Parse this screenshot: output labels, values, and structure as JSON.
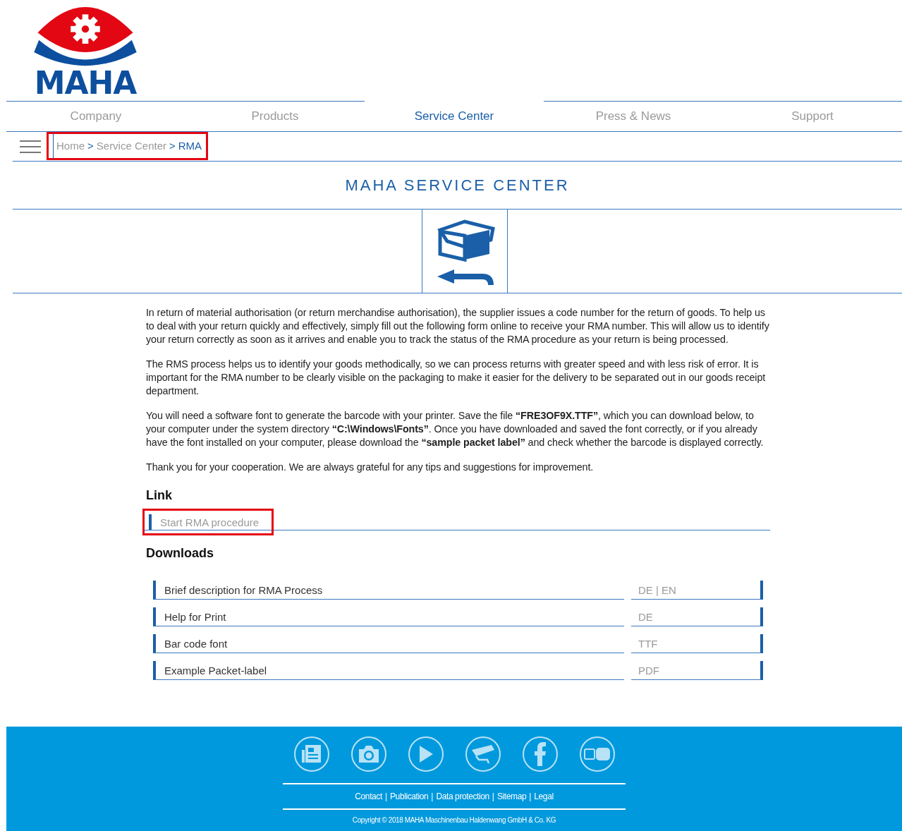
{
  "logo": {
    "text": "MAHA"
  },
  "nav": [
    {
      "label": "Company",
      "selected": false
    },
    {
      "label": "Products",
      "selected": false
    },
    {
      "label": "Service Center",
      "selected": true
    },
    {
      "label": "Press & News",
      "selected": false
    },
    {
      "label": "Support",
      "selected": false
    }
  ],
  "breadcrumb": {
    "highlighted": true,
    "items": [
      {
        "label": "Home",
        "current": false
      },
      {
        "label": "Service Center",
        "current": false
      },
      {
        "label": "RMA",
        "current": true
      }
    ],
    "separator": ">"
  },
  "title": "MAHA SERVICE CENTER",
  "paragraphs": [
    "In return of material authorisation (or return merchandise authorisation), the supplier issues a code number for the return of goods. To help us to deal with your return quickly and effectively, simply fill out the following form online to receive your RMA number. This will allow us to identify your return correctly as soon as it arrives and enable you to track the status of the RMA procedure as your return is being processed.",
    "The RMS process helps us to identify your goods methodically, so we can process returns with greater speed and with less risk of error. It is important for the RMA number to be clearly visible on the packaging to make it easier for the delivery to be separated out in our goods receipt department.",
    "You will need a software font to generate the barcode with your printer. Save the file **“FRE3OF9X.TTF”**, which you can download below, to your computer under the system directory **“C:\\Windows\\Fonts”**. Once you have downloaded and saved the font correctly, or if you already have the font installed on your computer, please download the **“sample packet label”** and check whether the barcode is displayed correctly.",
    "Thank you for your cooperation. We are always grateful for any tips and suggestions for improvement."
  ],
  "link_section": {
    "heading": "Link",
    "link": {
      "label": "Start RMA procedure",
      "highlighted": true
    }
  },
  "downloads": {
    "heading": "Downloads",
    "rows": [
      {
        "label": "Brief description for RMA Process",
        "format": "DE | EN"
      },
      {
        "label": "Help for Print",
        "format": "DE"
      },
      {
        "label": "Bar code font",
        "format": "TTF"
      },
      {
        "label": "Example Packet-label",
        "format": "PDF"
      }
    ]
  },
  "footer": {
    "social": [
      {
        "kind": "news"
      },
      {
        "kind": "camera"
      },
      {
        "kind": "play"
      },
      {
        "kind": "webcam"
      },
      {
        "kind": "facebook"
      },
      {
        "kind": "youtube"
      }
    ],
    "links": [
      "Contact",
      "Publication",
      "Data protection",
      "Sitemap",
      "Legal"
    ],
    "separator": "|",
    "copyright": "Copyright © 2018 MAHA Maschinenbau Haldenwang GmbH & Co. KG"
  }
}
